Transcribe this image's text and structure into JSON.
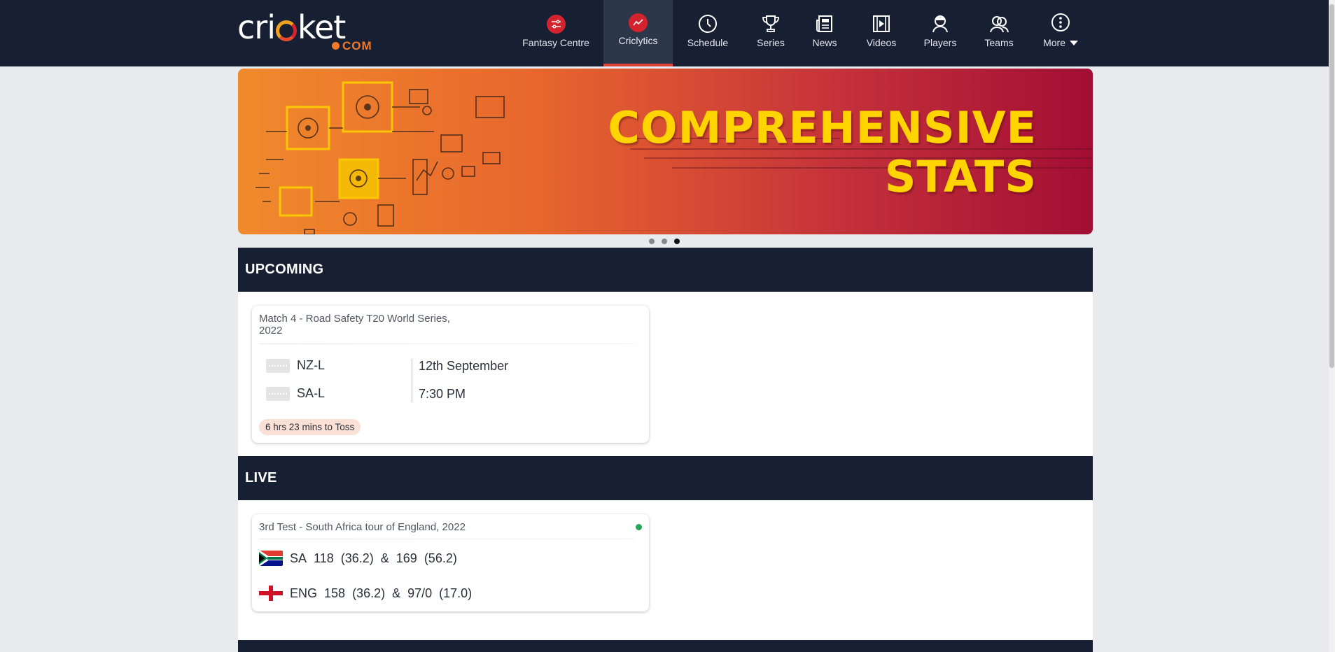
{
  "brand": {
    "wordmark_left": "cri",
    "wordmark_right": "ket",
    "suffix": "COM"
  },
  "nav": {
    "items": [
      {
        "label": "Fantasy Centre",
        "icon": "sliders-icon"
      },
      {
        "label": "Criclytics",
        "icon": "trend-line-icon",
        "active": true
      },
      {
        "label": "Schedule",
        "icon": "clock-icon"
      },
      {
        "label": "Series",
        "icon": "trophy-icon"
      },
      {
        "label": "News",
        "icon": "newspaper-icon"
      },
      {
        "label": "Videos",
        "icon": "film-icon"
      },
      {
        "label": "Players",
        "icon": "player-icon"
      },
      {
        "label": "Teams",
        "icon": "team-icon"
      },
      {
        "label": "More",
        "icon": "more-vertical-icon"
      }
    ]
  },
  "banner": {
    "line1": "COMPREHENSIVE",
    "line2": "STATS",
    "slides": 3,
    "active_slide": 3
  },
  "upcoming": {
    "heading": "UPCOMING",
    "match": {
      "title": "Match 4 - Road Safety T20 World Series, 2022",
      "title_line1": "Match 4 - Road Safety T20 World Series,",
      "title_line2": "2022",
      "team1": "NZ-L",
      "team2": "SA-L",
      "date": "12th September",
      "time": "7:30 PM",
      "toss_badge": "6 hrs 23 mins to Toss"
    }
  },
  "live": {
    "heading": "LIVE",
    "match": {
      "title": "3rd Test - South Africa tour of England, 2022",
      "rows": [
        {
          "team": "SA",
          "inn1": "118",
          "ov1": "(36.2)",
          "amp": "&",
          "inn2": "169",
          "ov2": "(56.2)"
        },
        {
          "team": "ENG",
          "inn1": "158",
          "ov1": "(36.2)",
          "amp": "&",
          "inn2": "97/0",
          "ov2": "(17.0)"
        }
      ]
    }
  },
  "colors": {
    "nav_bg": "#172033",
    "accent_red": "#e2403a",
    "headline_yellow": "#ffd400",
    "live_green": "#27a558"
  }
}
